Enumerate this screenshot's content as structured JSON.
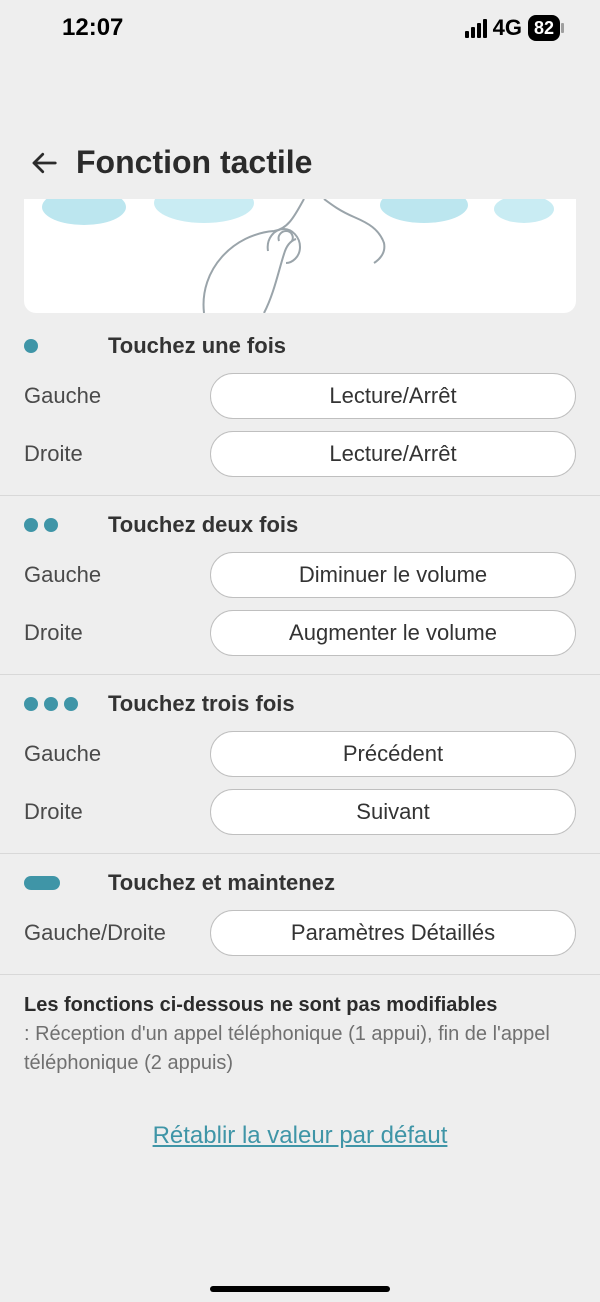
{
  "status": {
    "time": "12:07",
    "network": "4G",
    "battery_pct": "82"
  },
  "header": {
    "title": "Fonction tactile"
  },
  "sections": {
    "tap1": {
      "title": "Touchez une fois",
      "left_label": "Gauche",
      "left_value": "Lecture/Arrêt",
      "right_label": "Droite",
      "right_value": "Lecture/Arrêt"
    },
    "tap2": {
      "title": "Touchez deux fois",
      "left_label": "Gauche",
      "left_value": "Diminuer le volume",
      "right_label": "Droite",
      "right_value": "Augmenter le volume"
    },
    "tap3": {
      "title": "Touchez trois fois",
      "left_label": "Gauche",
      "left_value": "Précédent",
      "right_label": "Droite",
      "right_value": "Suivant"
    },
    "hold": {
      "title": "Touchez et maintenez",
      "label": "Gauche/Droite",
      "value": "Paramètres Détaillés"
    }
  },
  "footer": {
    "bold": "Les fonctions ci-dessous ne sont pas modifiables",
    "sub": ": Réception d'un appel téléphonique (1 appui), fin de l'appel téléphonique (2 appuis)"
  },
  "reset_link": "Rétablir la valeur par défaut"
}
